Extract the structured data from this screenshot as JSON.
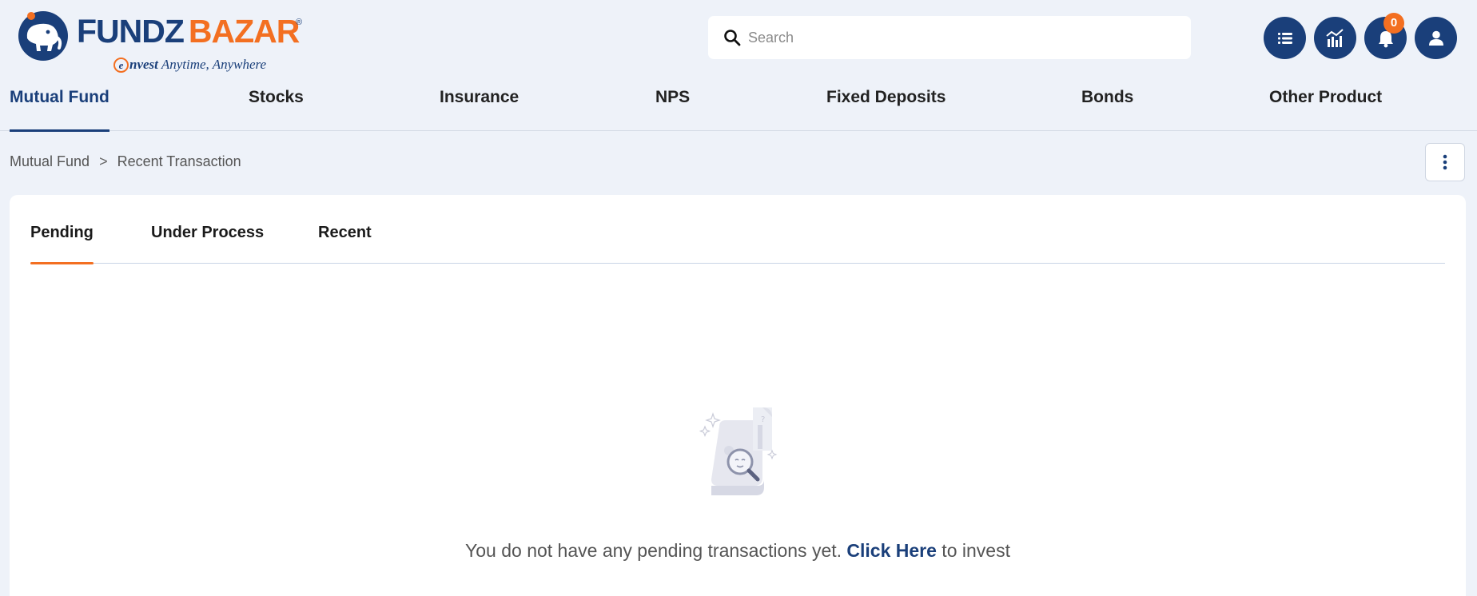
{
  "header": {
    "logo": {
      "word1": "FUNDZ",
      "word2": "BAZAR",
      "reg": "®",
      "tag_e": "e",
      "tag_invest": "nvest",
      "tag_rest": " Anytime, Anywhere"
    },
    "search": {
      "placeholder": "Search"
    },
    "buttons": [
      {
        "icon": "list-icon"
      },
      {
        "icon": "chart-icon"
      },
      {
        "icon": "bell-icon",
        "badge": "0"
      },
      {
        "icon": "user-icon"
      }
    ]
  },
  "nav": {
    "items": [
      {
        "label": "Mutual Fund",
        "active": true
      },
      {
        "label": "Stocks"
      },
      {
        "label": "Insurance"
      },
      {
        "label": "NPS"
      },
      {
        "label": "Fixed Deposits"
      },
      {
        "label": "Bonds"
      },
      {
        "label": "Other Product"
      }
    ]
  },
  "breadcrumb": {
    "parent": "Mutual Fund",
    "separator": ">",
    "current": "Recent Transaction"
  },
  "tabs": [
    {
      "label": "Pending",
      "active": true
    },
    {
      "label": "Under Process"
    },
    {
      "label": "Recent"
    }
  ],
  "empty_state": {
    "before": "You do not have any pending transactions yet. ",
    "link": "Click Here",
    "after": " to invest"
  },
  "colors": {
    "brand_blue": "#1a3f7a",
    "brand_orange": "#f36f21",
    "background": "#eef2f9"
  }
}
